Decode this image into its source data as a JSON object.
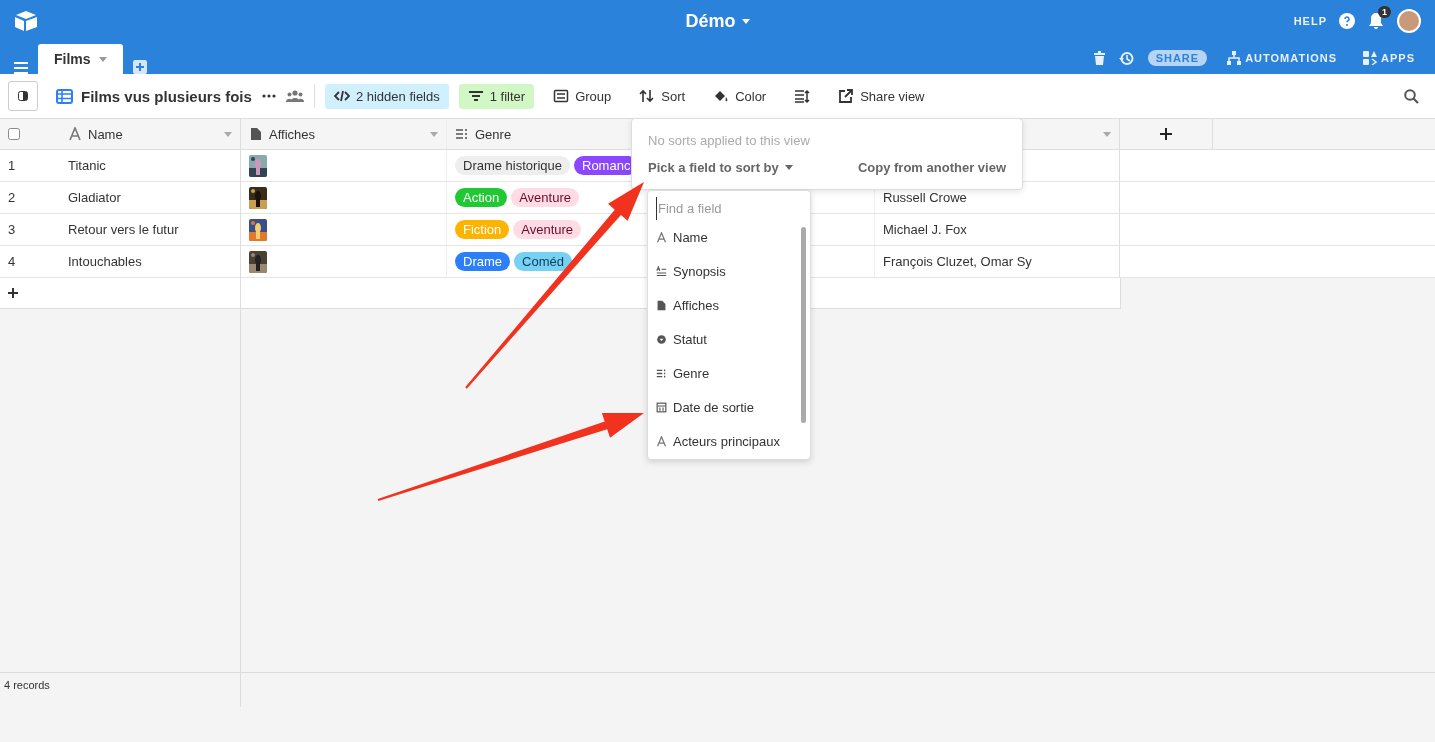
{
  "top_bar": {
    "base_title": "Démo",
    "help": "HELP",
    "notification_count": "1"
  },
  "tabs": [
    {
      "label": "Films",
      "selected": true
    }
  ],
  "tab_actions": [
    {
      "label": "SHARE",
      "kind": "pill"
    },
    {
      "label": "AUTOMATIONS",
      "kind": "automations"
    },
    {
      "label": "APPS",
      "kind": "apps"
    }
  ],
  "view_bar": {
    "view_name": "Films vus plusieurs fois",
    "buttons": [
      {
        "label": "2 hidden fields",
        "kind": "hidden"
      },
      {
        "label": "1 filter",
        "kind": "filter"
      },
      {
        "label": "Group",
        "kind": "group"
      },
      {
        "label": "Sort",
        "kind": "sort"
      },
      {
        "label": "Color",
        "kind": "color"
      },
      {
        "kind": "height"
      },
      {
        "label": "Share view",
        "kind": "share"
      }
    ]
  },
  "table": {
    "columns": [
      {
        "label": "Name",
        "kind": "text"
      },
      {
        "label": "Affiches",
        "kind": "attachment"
      },
      {
        "label": "Genre",
        "kind": "multi_select"
      },
      {
        "kind": "hidden"
      },
      {
        "kind": "blank"
      }
    ],
    "rows": [
      {
        "number": "1",
        "name": "Titanic",
        "genres": [
          {
            "label": "Drame historique",
            "color": "#eeeeee"
          },
          {
            "label": "Romanc",
            "color": "#8b46ff"
          }
        ],
        "column_5": ""
      },
      {
        "number": "2",
        "name": "Gladiator",
        "genres": [
          {
            "label": "Action",
            "color": "#20c933"
          },
          {
            "label": "Aventure",
            "color": "#ffdce5"
          }
        ],
        "column_5": "Russell Crowe"
      },
      {
        "number": "3",
        "name": "Retour vers le futur",
        "genres": [
          {
            "label": "Fiction",
            "color": "#fcb400"
          },
          {
            "label": "Aventure",
            "color": "#ffdce5"
          }
        ],
        "column_5": "Michael J. Fox"
      },
      {
        "number": "4",
        "name": "Intouchables",
        "genres": [
          {
            "label": "Drame",
            "color": "#2d7ff9"
          },
          {
            "label": "Coméd",
            "color": "#77d1f3"
          }
        ],
        "column_5": "François Cluzet, Omar Sy"
      }
    ]
  },
  "footer": {
    "record_count": "4 records"
  },
  "sort_popover": {
    "message": "No sorts applied to this view",
    "pick": "Pick a field to sort by",
    "copy": "Copy from another view",
    "field_menu": {
      "placeholder": "Find a field",
      "fields": [
        {
          "label": "Name",
          "kind": "text"
        },
        {
          "label": "Synopsis",
          "kind": "long_text"
        },
        {
          "label": "Affiches",
          "kind": "attachment"
        },
        {
          "label": "Statut",
          "kind": "single_select"
        },
        {
          "label": "Genre",
          "kind": "multi_select"
        },
        {
          "label": "Date de sortie",
          "kind": "date"
        },
        {
          "label": "Acteurs principaux",
          "kind": "text"
        }
      ]
    }
  }
}
